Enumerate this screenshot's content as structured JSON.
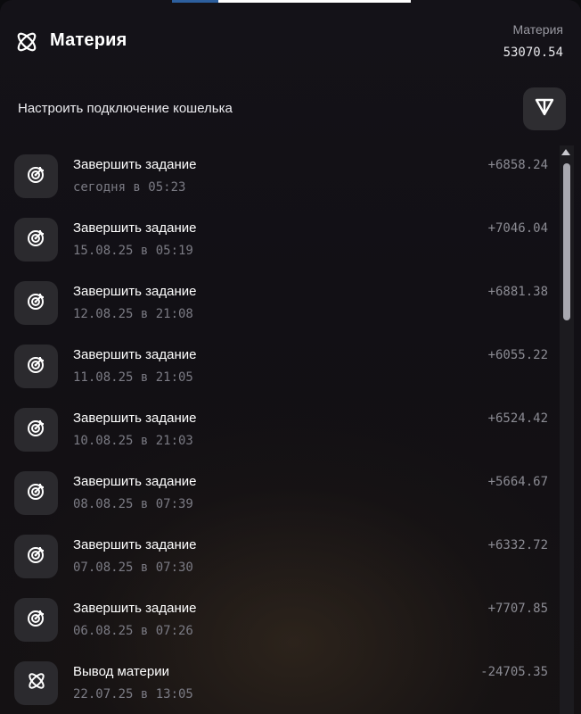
{
  "header": {
    "app_title": "Материя",
    "balance_label": "Материя",
    "balance_value": "53070.54"
  },
  "wallet": {
    "label": "Настроить подключение кошелька",
    "button_icon": "ton-icon"
  },
  "transactions": [
    {
      "icon": "target-icon",
      "title": "Завершить задание",
      "date": "сегодня в 05:23",
      "amount": "+6858.24"
    },
    {
      "icon": "target-icon",
      "title": "Завершить задание",
      "date": "15.08.25 в 05:19",
      "amount": "+7046.04"
    },
    {
      "icon": "target-icon",
      "title": "Завершить задание",
      "date": "12.08.25 в 21:08",
      "amount": "+6881.38"
    },
    {
      "icon": "target-icon",
      "title": "Завершить задание",
      "date": "11.08.25 в 21:05",
      "amount": "+6055.22"
    },
    {
      "icon": "target-icon",
      "title": "Завершить задание",
      "date": "10.08.25 в 21:03",
      "amount": "+6524.42"
    },
    {
      "icon": "target-icon",
      "title": "Завершить задание",
      "date": "08.08.25 в 07:39",
      "amount": "+5664.67"
    },
    {
      "icon": "target-icon",
      "title": "Завершить задание",
      "date": "07.08.25 в 07:30",
      "amount": "+6332.72"
    },
    {
      "icon": "target-icon",
      "title": "Завершить задание",
      "date": "06.08.25 в 07:26",
      "amount": "+7707.85"
    },
    {
      "icon": "atom-icon",
      "title": "Вывод материи",
      "date": "22.07.25 в 13:05",
      "amount": "-24705.35"
    }
  ]
}
